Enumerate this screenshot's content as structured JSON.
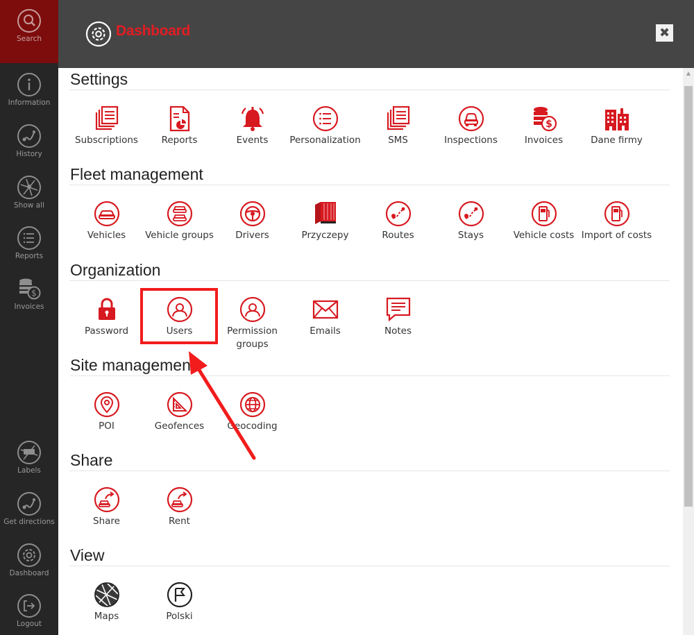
{
  "sidebar": {
    "items": [
      {
        "label": "Search",
        "icon": "search-icon",
        "active": true
      },
      {
        "label": "Information",
        "icon": "info-icon"
      },
      {
        "label": "History",
        "icon": "history-route-icon"
      },
      {
        "label": "Show all",
        "icon": "map-icon"
      },
      {
        "label": "Reports",
        "icon": "list-icon"
      },
      {
        "label": "Invoices",
        "icon": "coins-icon"
      },
      {
        "label": "Labels",
        "icon": "map-label-icon"
      },
      {
        "label": "Get directions",
        "icon": "directions-icon"
      },
      {
        "label": "Dashboard",
        "icon": "gear-icon"
      },
      {
        "label": "Logout",
        "icon": "logout-icon"
      }
    ]
  },
  "header": {
    "title": "Dashboard",
    "icon": "gear-icon",
    "close_label": "✖"
  },
  "sections": [
    {
      "title": "Settings",
      "items": [
        {
          "label": "Subscriptions",
          "icon": "documents-icon"
        },
        {
          "label": "Reports",
          "icon": "report-chart-icon"
        },
        {
          "label": "Events",
          "icon": "alarm-bell-icon"
        },
        {
          "label": "Personalization",
          "icon": "list-circle-icon"
        },
        {
          "label": "SMS",
          "icon": "documents-icon"
        },
        {
          "label": "Inspections",
          "icon": "car-front-circle-icon"
        },
        {
          "label": "Invoices",
          "icon": "coins-icon"
        },
        {
          "label": "Dane firmy",
          "icon": "buildings-icon"
        }
      ]
    },
    {
      "title": "Fleet management",
      "items": [
        {
          "label": "Vehicles",
          "icon": "car-circle-icon"
        },
        {
          "label": "Vehicle groups",
          "icon": "cars-circle-icon"
        },
        {
          "label": "Drivers",
          "icon": "steering-wheel-icon"
        },
        {
          "label": "Przyczepy",
          "icon": "trailer-icon"
        },
        {
          "label": "Routes",
          "icon": "route-circle-icon"
        },
        {
          "label": "Stays",
          "icon": "route-circle-icon"
        },
        {
          "label": "Vehicle costs",
          "icon": "fuel-pump-icon"
        },
        {
          "label": "Import of costs",
          "icon": "fuel-pump-icon"
        }
      ]
    },
    {
      "title": "Organization",
      "items": [
        {
          "label": "Password",
          "icon": "padlock-icon"
        },
        {
          "label": "Users",
          "icon": "user-circle-icon"
        },
        {
          "label": "Permission groups",
          "icon": "user-circle-icon"
        },
        {
          "label": "Emails",
          "icon": "envelope-icon"
        },
        {
          "label": "Notes",
          "icon": "note-bubble-icon"
        }
      ]
    },
    {
      "title": "Site management",
      "items": [
        {
          "label": "POI",
          "icon": "pin-circle-icon"
        },
        {
          "label": "Geofences",
          "icon": "set-square-icon"
        },
        {
          "label": "Geocoding",
          "icon": "globe-icon"
        }
      ]
    },
    {
      "title": "Share",
      "items": [
        {
          "label": "Share",
          "icon": "share-car-icon"
        },
        {
          "label": "Rent",
          "icon": "share-car-icon"
        }
      ]
    },
    {
      "title": "View",
      "items": [
        {
          "label": "Maps",
          "icon": "map-ball-icon"
        },
        {
          "label": "Polski",
          "icon": "flag-circle-icon"
        }
      ]
    }
  ],
  "colors": {
    "accent": "#e21d23",
    "sidebar_bg": "#262626",
    "sidebar_active_bg": "#7d0d0d",
    "header_bg": "#454545",
    "annotation": "#f21c1c"
  },
  "annotation": {
    "highlighted_item": "Users"
  }
}
